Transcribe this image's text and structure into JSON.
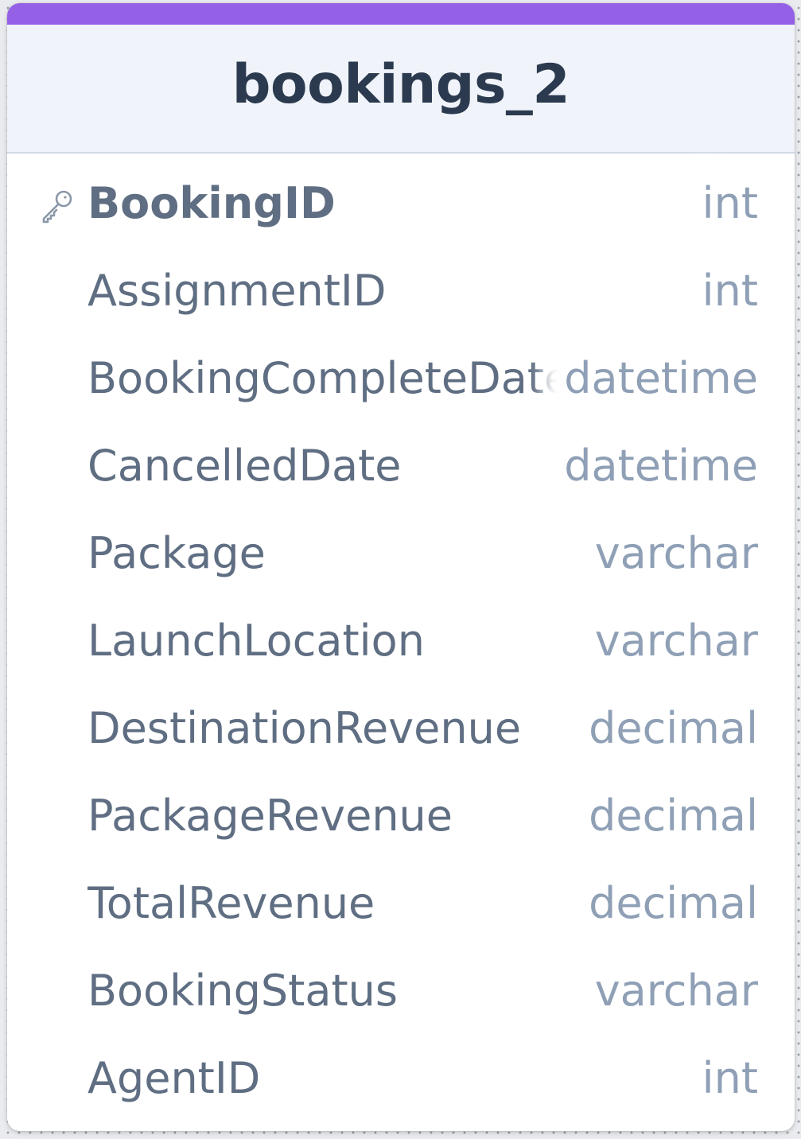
{
  "table": {
    "name": "bookings_2",
    "accent_color": "#9461e6",
    "columns": [
      {
        "name": "BookingID",
        "type": "int",
        "primary_key": true,
        "icon": "key-icon"
      },
      {
        "name": "AssignmentID",
        "type": "int"
      },
      {
        "name": "BookingCompleteDate",
        "type": "datetime"
      },
      {
        "name": "CancelledDate",
        "type": "datetime"
      },
      {
        "name": "Package",
        "type": "varchar"
      },
      {
        "name": "LaunchLocation",
        "type": "varchar"
      },
      {
        "name": "DestinationRevenue",
        "type": "decimal"
      },
      {
        "name": "PackageRevenue",
        "type": "decimal"
      },
      {
        "name": "TotalRevenue",
        "type": "decimal"
      },
      {
        "name": "BookingStatus",
        "type": "varchar"
      },
      {
        "name": "AgentID",
        "type": "int"
      }
    ]
  }
}
